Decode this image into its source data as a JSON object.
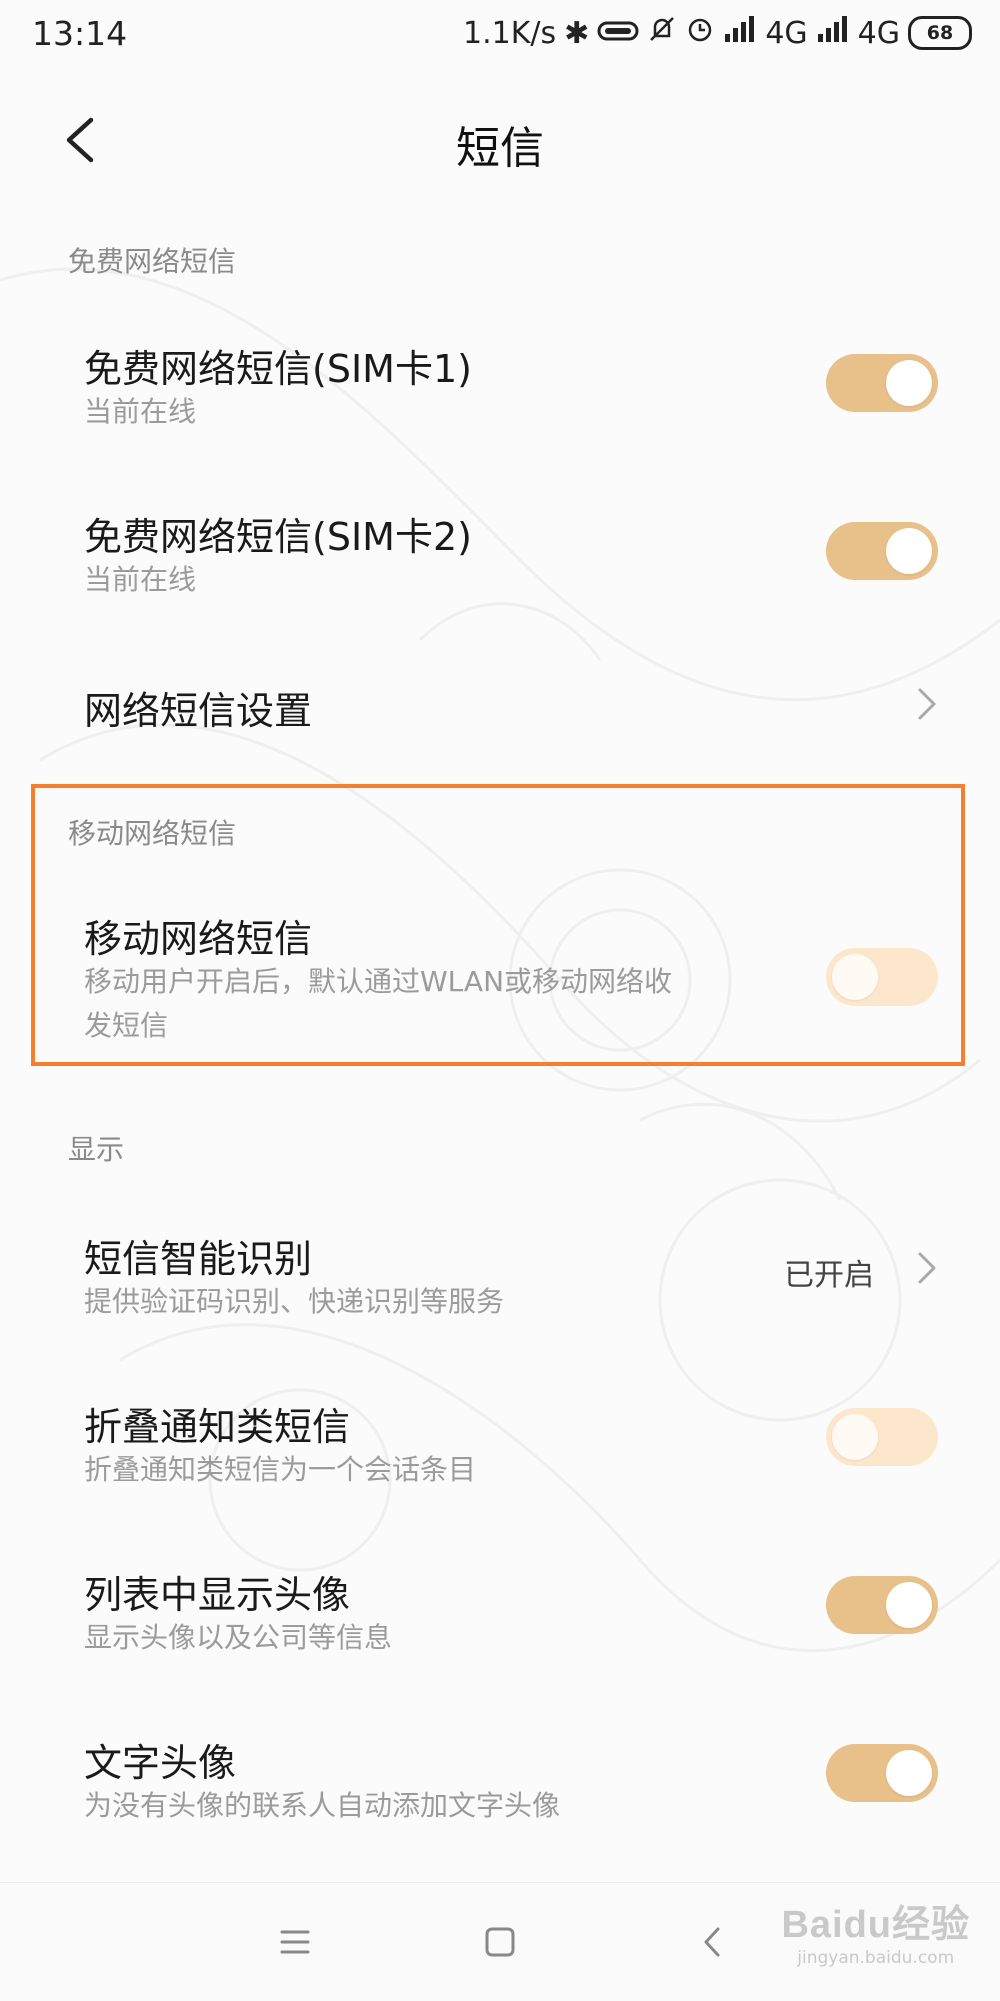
{
  "status_bar": {
    "time": "13:14",
    "net_speed": "1.1K/s",
    "signal1": "4G",
    "signal2": "4G",
    "hd_label": "HD",
    "battery": "68"
  },
  "header": {
    "title": "短信"
  },
  "sections": {
    "free": {
      "title": "免费网络短信",
      "items": [
        {
          "title": "免费网络短信(SIM卡1)",
          "subtitle": "当前在线",
          "state": "on"
        },
        {
          "title": "免费网络短信(SIM卡2)",
          "subtitle": "当前在线",
          "state": "on"
        },
        {
          "title": "网络短信设置"
        }
      ]
    },
    "mobile": {
      "title": "移动网络短信",
      "items": [
        {
          "title": "移动网络短信",
          "subtitle_line1": "移动用户开启后，默认通过WLAN或移动网络收",
          "subtitle_line2": "发短信",
          "state": "off"
        }
      ]
    },
    "display": {
      "title": "显示",
      "items": [
        {
          "title": "短信智能识别",
          "subtitle": "提供验证码识别、快递识别等服务",
          "value": "已开启"
        },
        {
          "title": "折叠通知类短信",
          "subtitle": "折叠通知类短信为一个会话条目",
          "state": "off"
        },
        {
          "title": "列表中显示头像",
          "subtitle": "显示头像以及公司等信息",
          "state": "on"
        },
        {
          "title": "文字头像",
          "subtitle": "为没有头像的联系人自动添加文字头像",
          "state": "on"
        }
      ]
    }
  },
  "watermark": {
    "logo": "Baidu经验",
    "url": "jingyan.baidu.com"
  },
  "colors": {
    "toggle_on": "#e8c089",
    "toggle_off": "#fde7cc",
    "highlight": "#f37f2f"
  }
}
